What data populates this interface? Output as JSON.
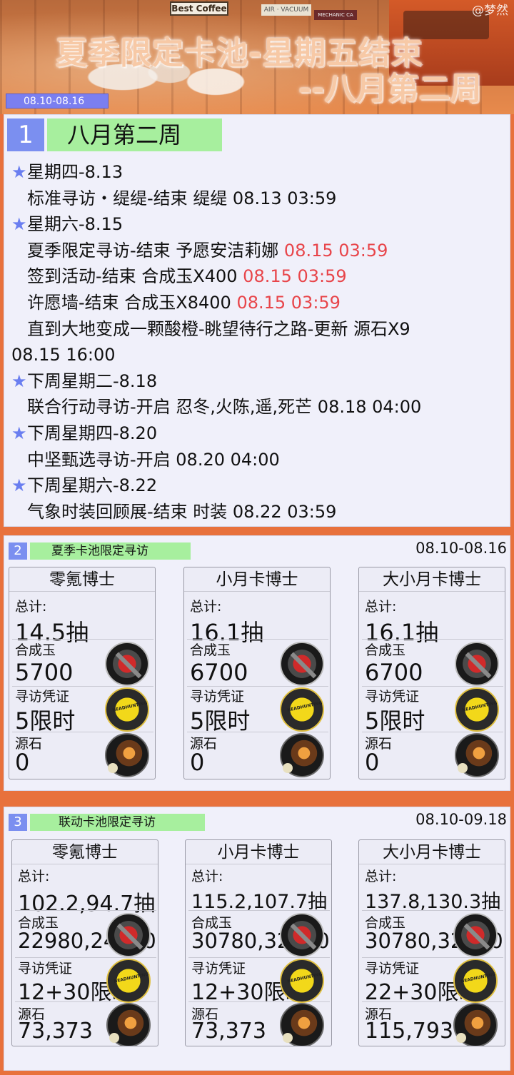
{
  "banner": {
    "watermark": "@梦然",
    "shop_sign": "Best Coffee",
    "shop_sign2": "AIR · VACUUM",
    "shop_sign3": "MECHANIC CA",
    "title_line1": "夏季限定卡池-星期五结束",
    "title_line2": "--八月第二周",
    "date_range": "08.10-08.16"
  },
  "section1": {
    "number": "1",
    "title": "八月第二周",
    "days": [
      {
        "day": "星期四-8.13",
        "items": [
          {
            "text": "标准寻访・缇缇-结束 缇缇 08.13 03:59",
            "highlight": ""
          }
        ]
      },
      {
        "day": "星期六-8.15",
        "items": [
          {
            "text": "夏季限定寻访-结束 予愿安洁莉娜 ",
            "highlight": "08.15 03:59"
          },
          {
            "text": "签到活动-结束 合成玉X400 ",
            "highlight": "08.15 03:59"
          },
          {
            "text": "许愿墙-结束 合成玉X8400 ",
            "highlight": "08.15 03:59"
          },
          {
            "text": "直到大地变成一颗酸橙-眺望待行之路-更新 源石X9",
            "highlight": ""
          }
        ],
        "extra_line": "08.15 16:00"
      },
      {
        "day": "下周星期二-8.18",
        "items": [
          {
            "text": "联合行动寻访-开启 忍冬,火陈,遥,死芒 08.18 04:00",
            "highlight": ""
          }
        ]
      },
      {
        "day": "下周星期四-8.20",
        "items": [
          {
            "text": "中坚甄选寻访-开启 08.20 04:00",
            "highlight": ""
          }
        ]
      },
      {
        "day": "下周星期六-8.22",
        "items": [
          {
            "text": "气象时装回顾展-结束 时装 08.22 03:59",
            "highlight": ""
          }
        ]
      }
    ]
  },
  "section2": {
    "number": "2",
    "title": "夏季卡池限定寻访",
    "range": "08.10-08.16",
    "labels": {
      "total": "总计:",
      "orundum": "合成玉",
      "permit": "寻访凭证",
      "prime": "源石"
    },
    "cards": [
      {
        "name": "零氪博士",
        "total": "14.5抽",
        "orundum": "5700",
        "permit": "5限时",
        "prime": "0"
      },
      {
        "name": "小月卡博士",
        "total": "16.1抽",
        "orundum": "6700",
        "permit": "5限时",
        "prime": "0"
      },
      {
        "name": "大小月卡博士",
        "total": "16.1抽",
        "orundum": "6700",
        "permit": "5限时",
        "prime": "0"
      }
    ]
  },
  "section3": {
    "number": "3",
    "title": "联动卡池限定寻访",
    "range": "08.10-09.18",
    "labels": {
      "total": "总计:",
      "orundum": "合成玉",
      "permit": "寻访凭证",
      "prime": "源石"
    },
    "cards": [
      {
        "name": "零氪博士",
        "total": "102.2,94.7抽",
        "orundum": "22980,24980",
        "permit": "12+30限时",
        "prime": "73,373"
      },
      {
        "name": "小月卡博士",
        "total": "115.2,107.7抽",
        "orundum": "30780,32780",
        "permit": "12+30限时",
        "prime": "73,373"
      },
      {
        "name": "大小月卡博士",
        "total": "137.8,130.3抽",
        "orundum": "30780,32780",
        "permit": "22+30限时",
        "prime": "115,793"
      }
    ]
  },
  "icons": {
    "star": "star-icon",
    "orundum": "orundum-icon",
    "permit": "headhunting-permit-icon",
    "prime": "originite-prime-icon"
  },
  "colors": {
    "accent_blue": "#7b8ff0",
    "accent_green": "#a7ef9e",
    "highlight_red": "#e8454a",
    "background_orange": "#e8713c"
  }
}
